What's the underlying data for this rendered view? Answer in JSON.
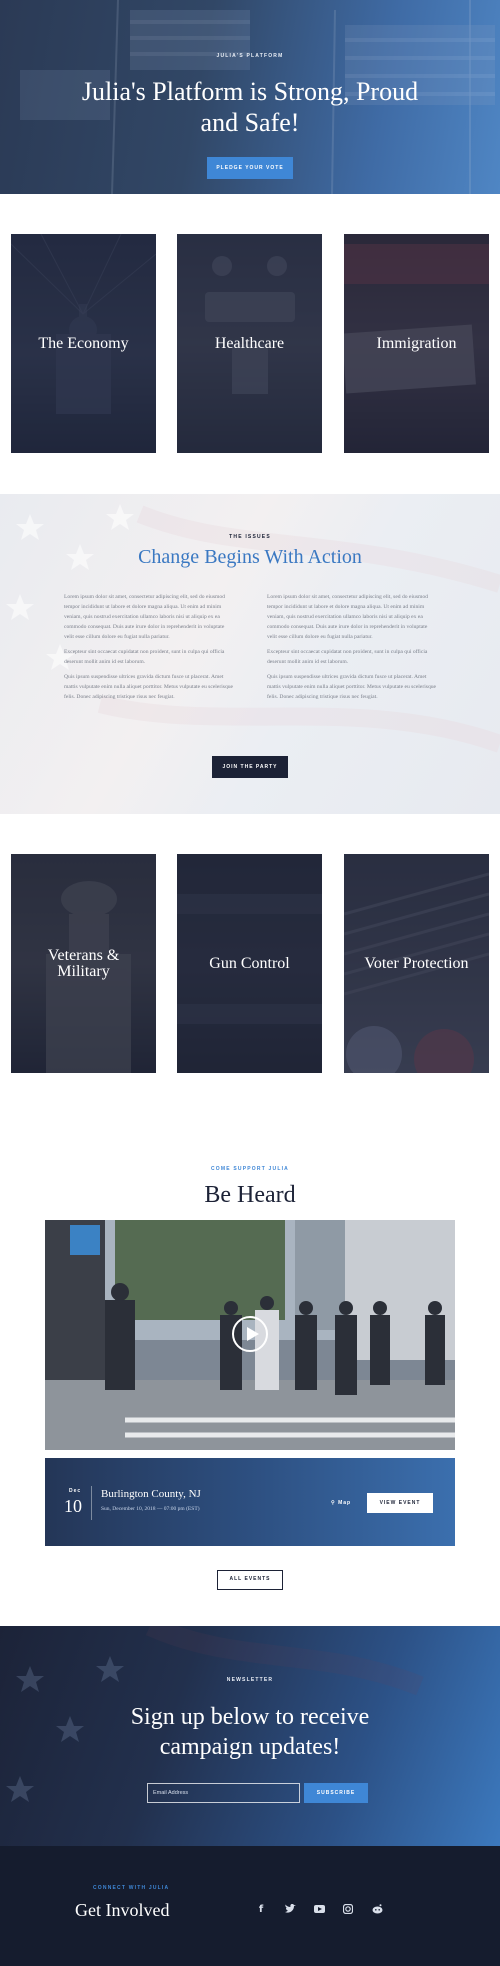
{
  "hero": {
    "eyebrow": "Julia's Platform",
    "title": "Julia's Platform is Strong, Proud and Safe!",
    "button": "Pledge Your Vote"
  },
  "cards_top": [
    {
      "label": "The Economy"
    },
    {
      "label": "Healthcare"
    },
    {
      "label": "Immigration"
    }
  ],
  "issues": {
    "eyebrow": "The Issues",
    "title": "Change Begins With Action",
    "col1": [
      "Lorem ipsum dolor sit amet, consectetur adipiscing elit, sed do eiusmod tempor incididunt ut labore et dolore magna aliqua. Ut enim ad minim veniam, quis nostrud exercitation ullamco laboris nisi ut aliquip ex ea commodo consequat. Duis aute irure dolor in reprehenderit in voluptate velit esse cillum dolore eu fugiat nulla pariatur.",
      "Excepteur sint occaecat cupidatat non proident, sunt in culpa qui officia deserunt mollit anim id est laborum.",
      "Quis ipsum suspendisse ultrices gravida dictum fusce ut placerat. Amet mattis vulputate enim nulla aliquet porttitor. Metus vulputate eu scelerisque felis. Donec adipiscing tristique risus nec feugiat."
    ],
    "col2": [
      "Lorem ipsum dolor sit amet, consectetur adipiscing elit, sed do eiusmod tempor incididunt ut labore et dolore magna aliqua. Ut enim ad minim veniam, quis nostrud exercitation ullamco laboris nisi ut aliquip ex ea commodo consequat. Duis aute irure dolor in reprehenderit in voluptate velit esse cillum dolore eu fugiat nulla pariatur.",
      "Excepteur sint occaecat cupidatat non proident, sunt in culpa qui officia deserunt mollit anim id est laborum.",
      "Quis ipsum suspendisse ultrices gravida dictum fusce ut placerat. Amet mattis vulputate enim nulla aliquet porttitor. Metus vulputate eu scelerisque felis. Donec adipiscing tristique risus nec feugiat."
    ],
    "button": "Join The Party"
  },
  "cards_bottom": [
    {
      "label": "Veterans & Military"
    },
    {
      "label": "Gun Control"
    },
    {
      "label": "Voter Protection"
    }
  ],
  "events": {
    "eyebrow": "Come Support Julia",
    "title": "Be Heard",
    "event": {
      "month": "Dec",
      "day": "10",
      "place": "Burlington County, NJ",
      "when": "Sun, December 10, 2018 — 07:00 pm (EST)",
      "map": "Map",
      "button": "View Event"
    },
    "all_button": "All Events"
  },
  "newsletter": {
    "eyebrow": "Newsletter",
    "title": "Sign up below to receive campaign updates!",
    "email_placeholder": "Email Address",
    "button": "Subscribe"
  },
  "footer": {
    "eyebrow": "Connect With Julia",
    "title": "Get Involved",
    "icons": [
      "facebook-icon",
      "twitter-icon",
      "youtube-icon",
      "instagram-icon",
      "reddit-icon"
    ]
  },
  "colors": {
    "accent": "#3f87d6",
    "navy": "#1c2236",
    "issues_title": "#3a78c2"
  }
}
